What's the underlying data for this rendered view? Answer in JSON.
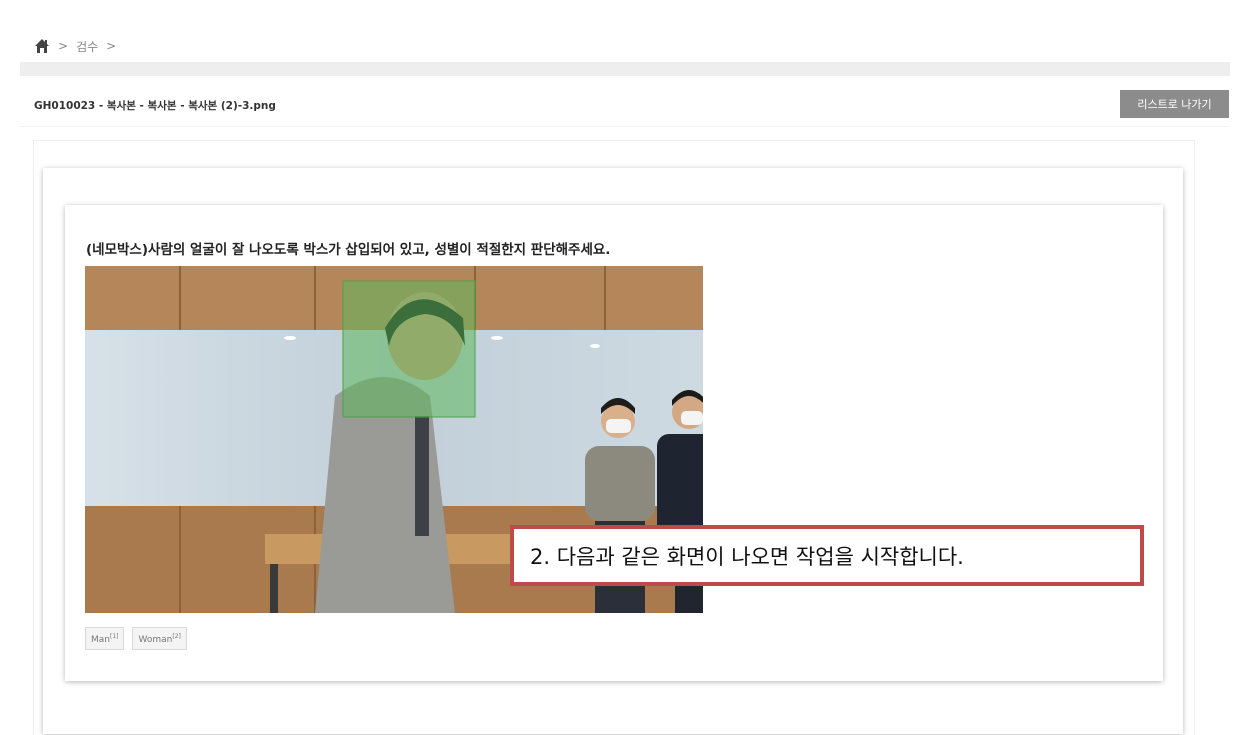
{
  "breadcrumb": {
    "icon": "home-icon",
    "separator": ">",
    "current": "검수",
    "trailing": ">"
  },
  "file": {
    "title": "GH010023 - 복사본 - 복사본 - 복사본 (2)-3.png"
  },
  "actions": {
    "back_label": "리스트로 나가기"
  },
  "task": {
    "question": "(네모박스)사람의 얼굴이 잘 나오도록 박스가 삽입되어 있고, 성별이 적절한지 판단해주세요."
  },
  "labels": [
    {
      "name": "Man",
      "key": "[1]"
    },
    {
      "name": "Woman",
      "key": "[2]"
    }
  ],
  "callout": {
    "text": "2. 다음과 같은 화면이 나오면 작업을 시작합니다."
  },
  "colors": {
    "bounding_box": "#5cb85c",
    "callout_border": "#bf4a4a",
    "button_bg": "#8c8c8c"
  }
}
